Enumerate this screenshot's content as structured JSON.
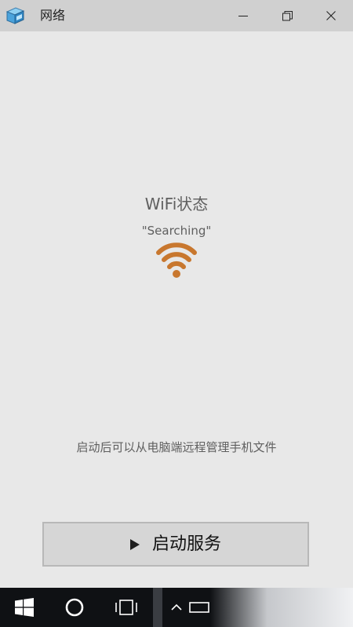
{
  "window": {
    "title": "网络",
    "icon": "network-computer-icon",
    "controls": [
      "minimize-icon",
      "restore-icon",
      "close-icon"
    ]
  },
  "main": {
    "status_title": "WiFi状态",
    "status_value": "\"Searching\"",
    "status_icon": "wifi-icon",
    "hint": "启动后可以从电脑端远程管理手机文件",
    "start_button_label": "启动服务",
    "start_button_icon": "play-icon"
  },
  "taskbar": {
    "items": [
      "windows-start-icon",
      "cortana-search-icon",
      "task-view-icon",
      "show-hidden-icons-chevron",
      "tablet-mode-icon"
    ]
  },
  "colors": {
    "background": "#e8e8e8",
    "titlebar": "#d0d0d0",
    "wifi_accent": "#c8772e",
    "taskbar": "#0f1114",
    "button": "#d6d6d6"
  }
}
